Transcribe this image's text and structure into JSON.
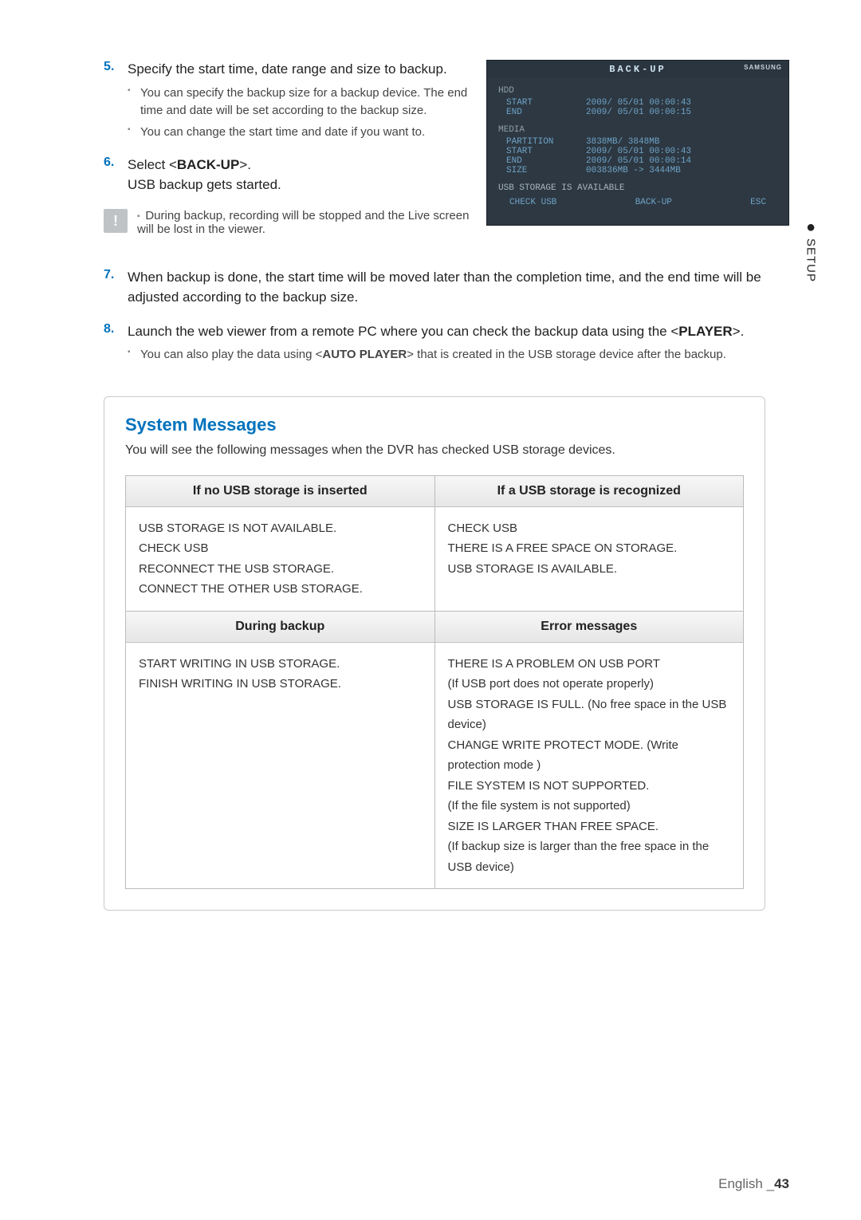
{
  "side_tab": {
    "label": "SETUP"
  },
  "steps": {
    "s5": {
      "num": "5.",
      "text": "Specify the start time, date range and size to backup.",
      "subs": [
        "You can specify the backup size for a backup device. The end time and date will be set according to the backup size.",
        "You can change the start time and date if you want to."
      ]
    },
    "s6": {
      "num": "6.",
      "text_pre": "Select <",
      "text_bold": "BACK-UP",
      "text_post": ">.",
      "line2": "USB backup gets started."
    },
    "note": "During backup, recording will be stopped and the Live screen will be lost in the viewer.",
    "s7": {
      "num": "7.",
      "text": "When backup is done, the start time will be moved later than the completion time, and the end time will be adjusted according to the backup size."
    },
    "s8": {
      "num": "8.",
      "text_pre": "Launch the web viewer from a remote PC where you can check the backup data using the <",
      "text_bold": "PLAYER",
      "text_post": ">.",
      "sub_pre": "You can also play the data using <",
      "sub_bold": "AUTO PLAYER",
      "sub_post": "> that is created in the USB storage device after the backup."
    }
  },
  "panel": {
    "title": "BACK-UP",
    "brand": "SAMSUNG",
    "groups": [
      {
        "head": "HDD",
        "rows": [
          {
            "label": "START",
            "value": "2009/ 05/01   00:00:43"
          },
          {
            "label": "END",
            "value": "2009/ 05/01   00:00:15"
          }
        ]
      },
      {
        "head": "MEDIA",
        "rows": [
          {
            "label": "PARTITION",
            "value": "3838MB/ 3848MB"
          },
          {
            "label": "START",
            "value": "2009/ 05/01   00:00:43"
          },
          {
            "label": "END",
            "value": "2009/ 05/01   00:00:14"
          },
          {
            "label": "SIZE",
            "value": "003836MB  ->   3444MB"
          }
        ]
      }
    ],
    "status": "USB STORAGE IS AVAILABLE",
    "footer": {
      "left": "CHECK USB",
      "mid": "BACK-UP",
      "right": "ESC"
    }
  },
  "sys": {
    "title": "System Messages",
    "subtitle": "You will see the following messages when the DVR has checked USB storage devices.",
    "headers": {
      "h1": "If no USB storage is inserted",
      "h2": "If a USB storage is recognized",
      "h3": "During backup",
      "h4": "Error messages"
    },
    "cells": {
      "c1": "USB STORAGE IS NOT AVAILABLE.\nCHECK USB\nRECONNECT THE USB STORAGE.\nCONNECT THE OTHER USB STORAGE.",
      "c2": "CHECK USB\nTHERE IS A FREE SPACE ON STORAGE.\nUSB STORAGE IS AVAILABLE.",
      "c3": "START WRITING IN USB STORAGE.\nFINISH WRITING IN USB STORAGE.",
      "c4": "THERE IS A PROBLEM ON USB PORT\n(If USB port does not operate properly)\nUSB STORAGE IS FULL. (No free space in the USB device)\nCHANGE WRITE PROTECT MODE. (Write protection mode )\nFILE SYSTEM IS NOT SUPPORTED.\n(If the file system is not supported)\nSIZE IS LARGER THAN FREE SPACE.\n(If backup size is larger than the free space in the USB device)"
    }
  },
  "footer": {
    "lang": "English",
    "sep": "_",
    "page": "43"
  }
}
